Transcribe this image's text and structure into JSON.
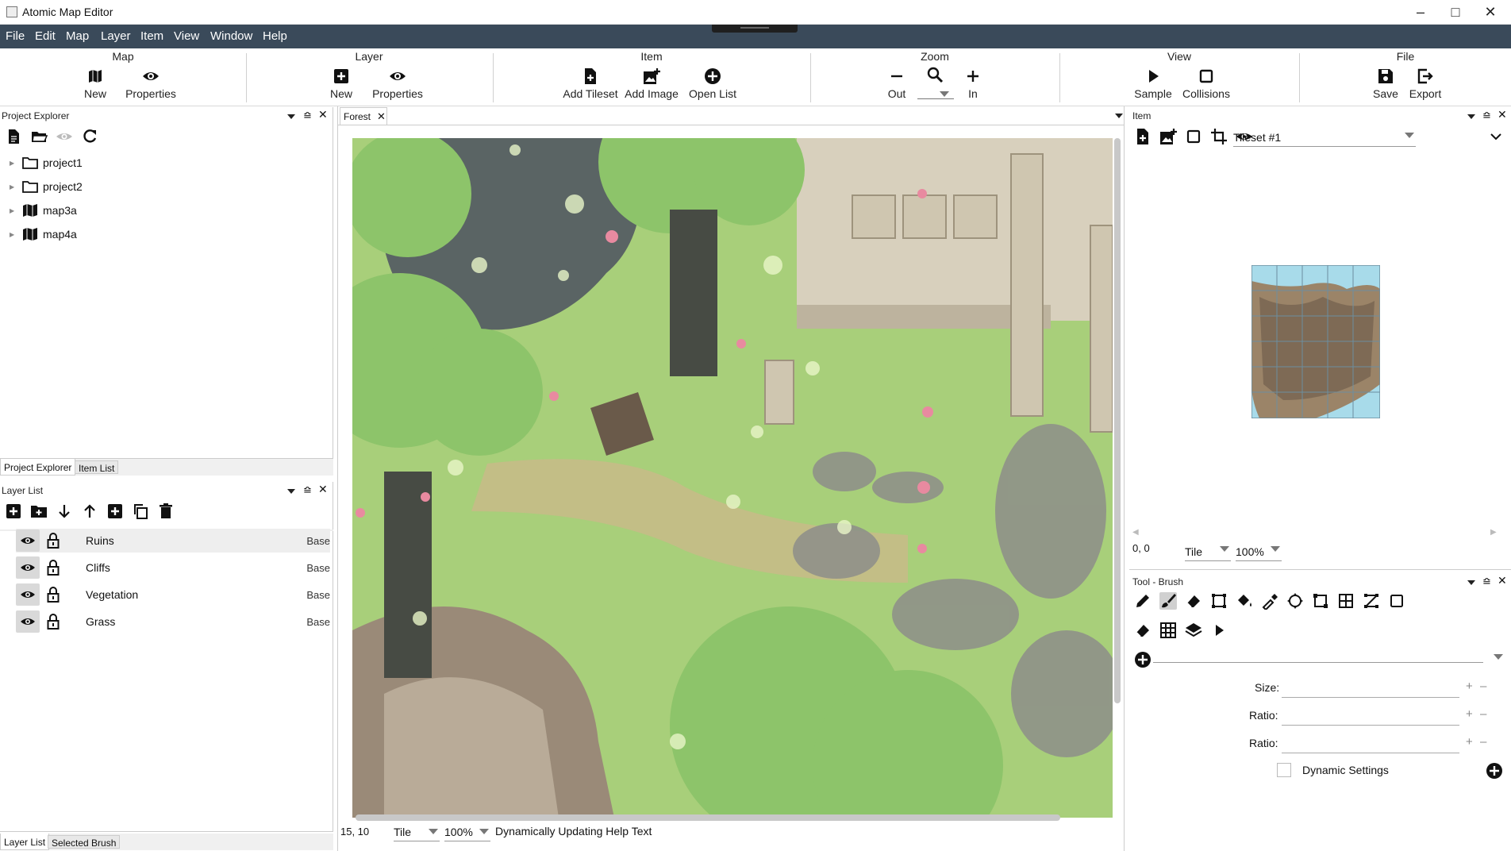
{
  "app": {
    "title": "Atomic Map Editor"
  },
  "menu": [
    "File",
    "Edit",
    "Map",
    "Layer",
    "Item",
    "View",
    "Window",
    "Help"
  ],
  "ribbon": {
    "map": {
      "title": "Map",
      "new": "New",
      "properties": "Properties"
    },
    "layer": {
      "title": "Layer",
      "new": "New",
      "properties": "Properties"
    },
    "item": {
      "title": "Item",
      "add_tileset": "Add Tileset",
      "add_image": "Add Image",
      "open_list": "Open List"
    },
    "zoom": {
      "title": "Zoom",
      "out": "Out",
      "in": "In"
    },
    "view": {
      "title": "View",
      "sample": "Sample",
      "collisions": "Collisions"
    },
    "file": {
      "title": "File",
      "save": "Save",
      "export": "Export"
    }
  },
  "project_explorer": {
    "title": "Project Explorer",
    "items": [
      {
        "label": "project1",
        "icon": "folder-icon"
      },
      {
        "label": "project2",
        "icon": "folder-icon"
      },
      {
        "label": "map3a",
        "icon": "map-icon"
      },
      {
        "label": "map4a",
        "icon": "map-icon"
      }
    ],
    "tabs": [
      "Project Explorer",
      "Item List"
    ]
  },
  "layer_list": {
    "title": "Layer List",
    "layers": [
      {
        "name": "Ruins",
        "type": "Base"
      },
      {
        "name": "Cliffs",
        "type": "Base"
      },
      {
        "name": "Vegetation",
        "type": "Base"
      },
      {
        "name": "Grass",
        "type": "Base"
      }
    ],
    "tabs": [
      "Layer List",
      "Selected Brush"
    ]
  },
  "document": {
    "tab": "Forest",
    "coords": "15, 10",
    "mode": "Tile",
    "zoom": "100%",
    "help": "Dynamically Updating Help Text"
  },
  "item_panel": {
    "title": "Item",
    "tileset": "Tileset #1",
    "coords": "0, 0",
    "mode": "Tile",
    "zoom": "100%"
  },
  "tool_panel": {
    "title": "Tool - Brush",
    "fields": [
      "Size:",
      "Ratio:",
      "Ratio:"
    ],
    "dynamic": "Dynamic Settings"
  },
  "colors": {
    "menubar": "#3a4a5a",
    "grass": "#a8cf7a",
    "water": "#5a6464",
    "tree": "#8dc46a"
  }
}
